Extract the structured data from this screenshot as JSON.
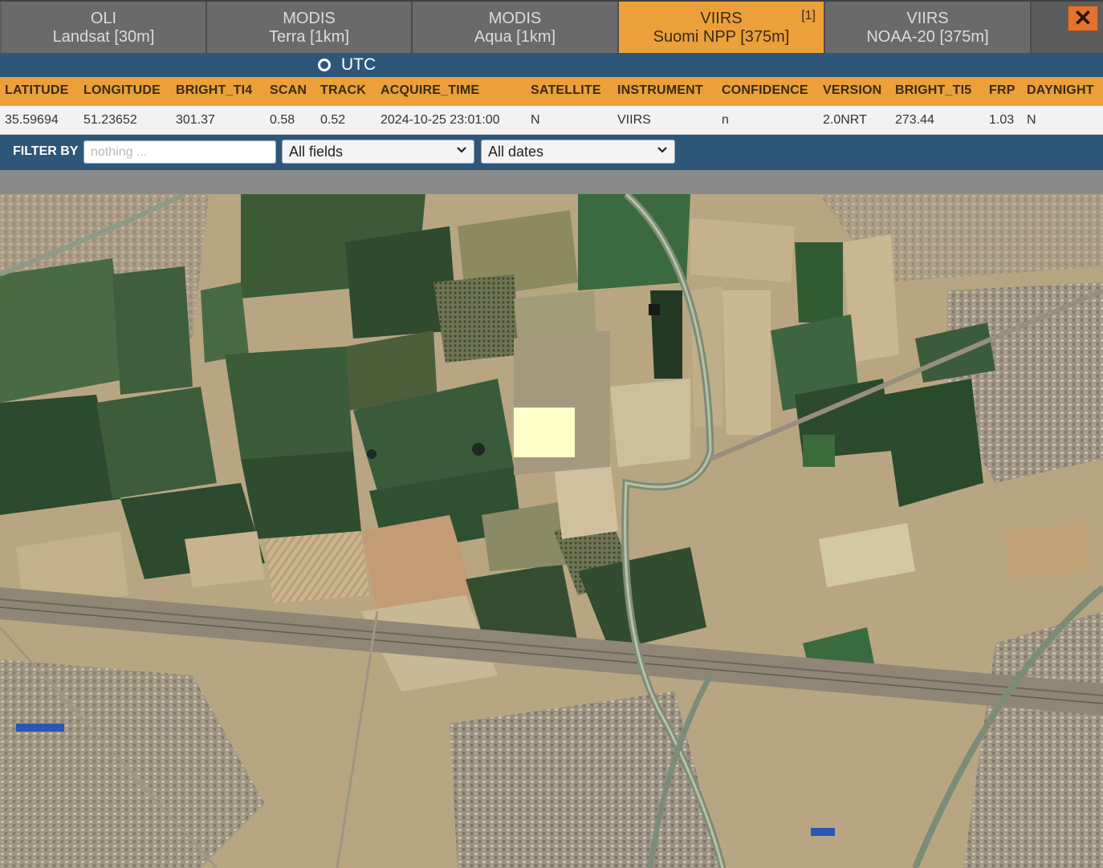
{
  "tabs": [
    {
      "line1": "OLI",
      "line2": "Landsat [30m]",
      "active": false
    },
    {
      "line1": "MODIS",
      "line2": "Terra [1km]",
      "active": false
    },
    {
      "line1": "MODIS",
      "line2": "Aqua [1km]",
      "active": false
    },
    {
      "line1": "VIIRS",
      "line2": "Suomi NPP [375m]",
      "active": true,
      "badge": "[1]"
    },
    {
      "line1": "VIIRS",
      "line2": "NOAA-20 [375m]",
      "active": false
    }
  ],
  "close_label": "✕",
  "utc_label": "UTC",
  "table": {
    "columns": [
      "LATITUDE",
      "LONGITUDE",
      "BRIGHT_TI4",
      "SCAN",
      "TRACK",
      "ACQUIRE_TIME",
      "SATELLITE",
      "INSTRUMENT",
      "CONFIDENCE",
      "VERSION",
      "BRIGHT_TI5",
      "FRP",
      "DAYNIGHT"
    ],
    "rows": [
      [
        "35.59694",
        "51.23652",
        "301.37",
        "0.58",
        "0.52",
        "2024-10-25 23:01:00",
        "N",
        "VIIRS",
        "n",
        "2.0NRT",
        "273.44",
        "1.03",
        "N"
      ]
    ]
  },
  "filter": {
    "label": "FILTER BY",
    "placeholder": "nothing ...",
    "field_select": "All fields",
    "date_select": "All dates"
  },
  "colors": {
    "accent": "#eba03a",
    "header_blue": "#2d5679",
    "fire_marker": "#ffffc8"
  }
}
